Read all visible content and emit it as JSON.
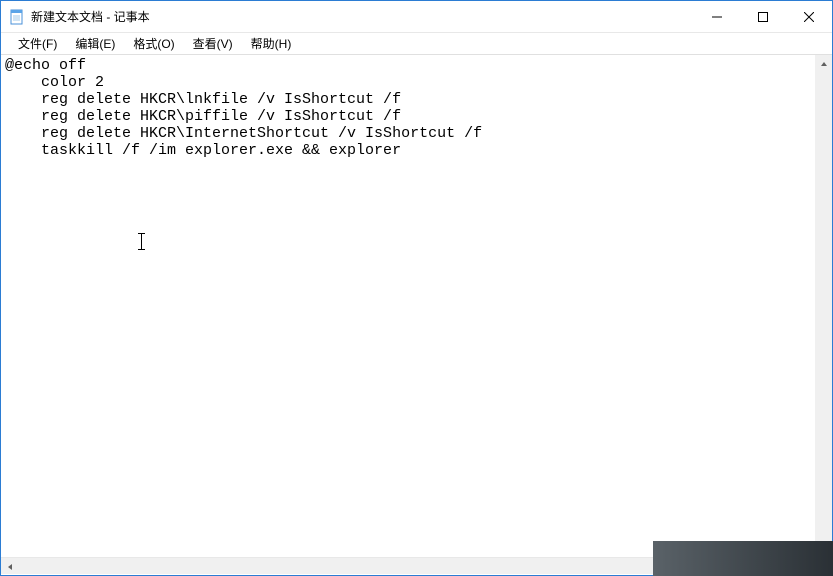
{
  "window": {
    "title": "新建文本文档 - 记事本"
  },
  "menu": {
    "file": "文件(F)",
    "edit": "编辑(E)",
    "format": "格式(O)",
    "view": "查看(V)",
    "help": "帮助(H)"
  },
  "editor": {
    "content": "@echo off\n    color 2\n    reg delete HKCR\\lnkfile /v IsShortcut /f\n    reg delete HKCR\\piffile /v IsShortcut /f\n    reg delete HKCR\\InternetShortcut /v IsShortcut /f\n    taskkill /f /im explorer.exe && explorer"
  }
}
